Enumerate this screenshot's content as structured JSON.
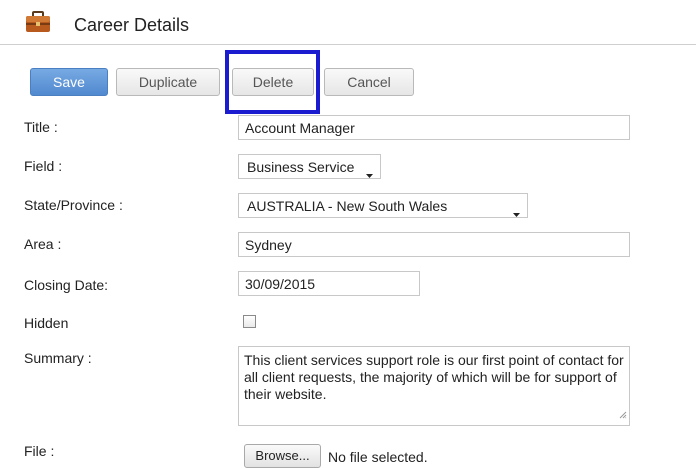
{
  "header": {
    "title": "Career Details",
    "icon": "briefcase-icon"
  },
  "toolbar": {
    "save_label": "Save",
    "duplicate_label": "Duplicate",
    "delete_label": "Delete",
    "cancel_label": "Cancel",
    "highlighted": "Delete"
  },
  "form": {
    "title": {
      "label": "Title :",
      "value": "Account Manager"
    },
    "field": {
      "label": "Field :",
      "value": "Business Service"
    },
    "state": {
      "label": "State/Province :",
      "value": "AUSTRALIA - New South Wales"
    },
    "area": {
      "label": "Area :",
      "value": "Sydney"
    },
    "closing_date": {
      "label": "Closing Date:",
      "value": "30/09/2015"
    },
    "hidden": {
      "label": "Hidden",
      "checked": false
    },
    "summary": {
      "label": "Summary :",
      "value": "This client services support role is our first point of contact for all client requests, the majority of which will be for support of their website."
    },
    "file": {
      "label": "File :",
      "browse_label": "Browse...",
      "status": "No file selected."
    }
  },
  "colors": {
    "save_button": "#5f95d6",
    "highlight_border": "#1b1bd0",
    "briefcase": "#b85a1e"
  }
}
